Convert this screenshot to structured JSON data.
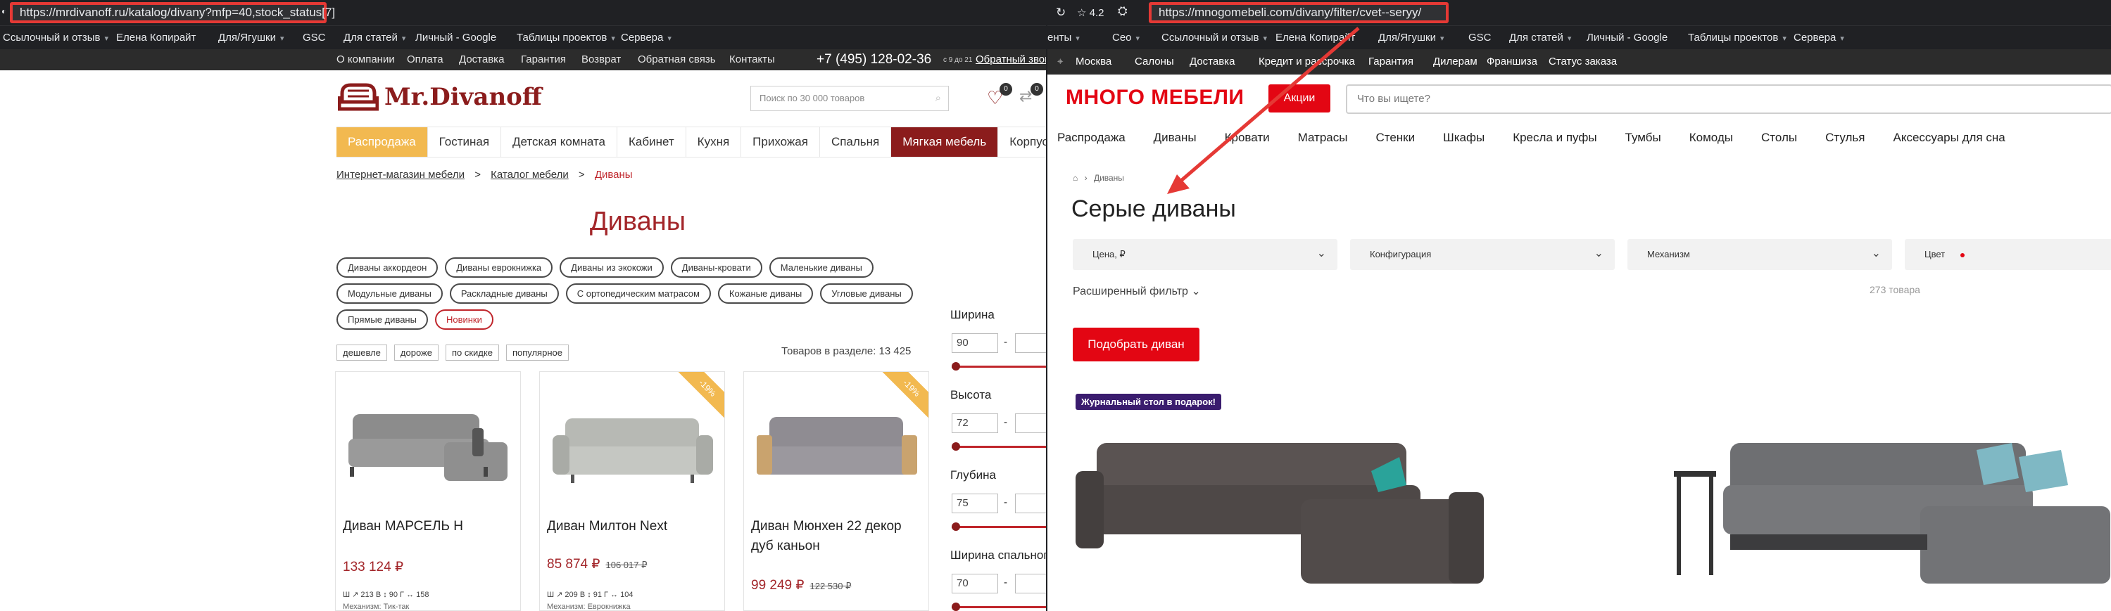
{
  "left": {
    "url": "https://mrdivanoff.ru/katalog/divany?mfp=40,stock_status[7]",
    "bookmarks": [
      "Ссылочный и отзыв",
      "Елена Копирайт",
      "Для/Ягушки",
      "GSC",
      "Для статей",
      "Личный - Google",
      "Таблицы проектов",
      "Сервера"
    ],
    "topnav": [
      "О компании",
      "Оплата",
      "Доставка",
      "Гарантия",
      "Возврат",
      "Обратная связь",
      "Контакты"
    ],
    "phone": "+7 (495) 128-02-36",
    "hours": "с 9 до 21",
    "callback": "Обратный звонок",
    "logo": "Mr.Divanoff",
    "search_placeholder": "Поиск по 30 000 товаров",
    "badge_count": "0",
    "categories": [
      "Распродажа",
      "Гостиная",
      "Детская комната",
      "Кабинет",
      "Кухня",
      "Прихожая",
      "Спальня",
      "Мягкая мебель",
      "Корпусная мебель"
    ],
    "crumbs": [
      "Интернет-магазин мебели",
      "Каталог мебели",
      "Диваны"
    ],
    "crumb_sep": ">",
    "title": "Диваны",
    "chips": [
      "Диваны аккордеон",
      "Диваны еврокнижка",
      "Диваны из экокожи",
      "Диваны-кровати",
      "Маленькие диваны",
      "Модульные диваны",
      "Раскладные диваны",
      "С ортопедическим матрасом",
      "Кожаные диваны",
      "Угловые диваны",
      "Прямые диваны",
      "Новинки"
    ],
    "sorts": [
      "дешевле",
      "дороже",
      "по скидке",
      "популярное"
    ],
    "count": "Товаров в разделе: 13 425",
    "products": [
      {
        "name": "Диван МАРСЕЛЬ Н",
        "price": "133 124 ₽",
        "old": "",
        "discount": "",
        "dims": "Ш ↗ 213   В ↕ 90   Г ↔ 158",
        "mech": "Механизм: Тик-так"
      },
      {
        "name": "Диван Милтон Next",
        "price": "85 874 ₽",
        "old": "106 017 ₽",
        "discount": "-19%",
        "dims": "Ш ↗ 209   В ↕ 91   Г ↔ 104",
        "mech": "Механизм: Еврокнижка"
      },
      {
        "name": "Диван Мюнхен 22 декор дуб каньон",
        "price": "99 249 ₽",
        "old": "122 530 ₽",
        "discount": "-19%",
        "dims": "",
        "mech": ""
      }
    ],
    "filters": [
      {
        "label": "Ширина",
        "value": "90"
      },
      {
        "label": "Высота",
        "value": "72"
      },
      {
        "label": "Глубина",
        "value": "75"
      },
      {
        "label": "Ширина спального",
        "value": "70"
      }
    ],
    "dash": "-"
  },
  "right": {
    "url": "https://mnogomebeli.com/divany/filter/cvet--seryy/",
    "star_rating": "4.2",
    "bookmarks": [
      "енты",
      "Сео",
      "Ссылочный и отзыв",
      "Елена Копирайт",
      "Для/Ягушки",
      "GSC",
      "Для статей",
      "Личный - Google",
      "Таблицы проектов",
      "Сервера"
    ],
    "topnav": [
      "Москва",
      "Салоны",
      "Доставка",
      "Кредит и рассрочка",
      "Гарантия",
      "Дилерам",
      "Франшиза",
      "Статус заказа"
    ],
    "logo": "МНОГО МЕБЕЛИ",
    "actions": "Акции",
    "search_placeholder": "Что вы ищете?",
    "categories": [
      "Распродажа",
      "Диваны",
      "Кровати",
      "Матрасы",
      "Стенки",
      "Шкафы",
      "Кресла и пуфы",
      "Тумбы",
      "Комоды",
      "Столы",
      "Стулья",
      "Аксессуары для сна"
    ],
    "crumb": "Диваны",
    "title": "Серые диваны",
    "selects": [
      "Цена, ₽",
      "Конфигурация",
      "Механизм",
      "Цвет"
    ],
    "advanced": "Расширенный фильтр",
    "count": "273 товара",
    "pick": "Подобрать диван",
    "promo": "Журнальный стол в подарок!"
  },
  "colors": {
    "accent_left": "#8b1c1c",
    "accent_right": "#e30613",
    "highlight_box": "#e53935"
  }
}
